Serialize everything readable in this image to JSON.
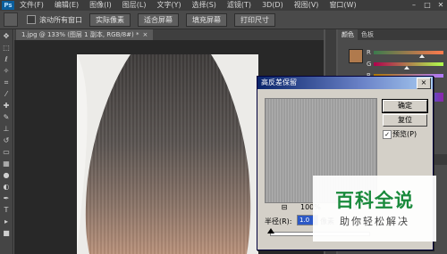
{
  "menubar": {
    "logo": "Ps",
    "items": [
      "文件(F)",
      "编辑(E)",
      "图像(I)",
      "图层(L)",
      "文字(Y)",
      "选择(S)",
      "滤镜(T)",
      "3D(D)",
      "视图(V)",
      "窗口(W)"
    ],
    "window_controls": [
      "–",
      "□",
      "✕"
    ]
  },
  "options_bar": {
    "scroll_all_label": "滚动所有窗口",
    "buttons": [
      "实际像素",
      "适合屏幕",
      "填充屏幕",
      "打印尺寸"
    ]
  },
  "document_tab": {
    "title": "1.jpg @ 133% (图层 1 副本, RGB/8#) *",
    "close": "×"
  },
  "panel": {
    "tabs": [
      "颜色",
      "色板"
    ],
    "foreground_color": "#b07a4d",
    "sliders": [
      {
        "label": "R",
        "gradient": [
          "#3b7a4d",
          "#ff7a4d"
        ],
        "value": 176
      },
      {
        "label": "G",
        "gradient": [
          "#b0004d",
          "#b0ff4d"
        ],
        "value": 122
      },
      {
        "label": "B",
        "gradient": [
          "#b07a00",
          "#b07aff"
        ],
        "value": 77
      }
    ]
  },
  "dialog": {
    "title": "高反差保留",
    "close": "×",
    "ok_label": "确定",
    "reset_label": "复位",
    "preview_checkbox": {
      "checked": true,
      "mark": "✓",
      "label": "预览(P)"
    },
    "zoom": {
      "minus": "⊟",
      "value": "100%",
      "plus": "⊞"
    },
    "radius": {
      "label": "半径(R):",
      "value": "1.0",
      "unit": "像素",
      "slider_position": 0
    }
  },
  "watermark": {
    "title": "百科全说",
    "subtitle": "助你轻松解决"
  },
  "colors": {
    "menubar_bg": "#3c3c3c",
    "workspace_bg": "#535353",
    "dialog_bg": "#d4d0c8",
    "dialog_title_from": "#0a246a",
    "watermark_green": "#1a8a3c"
  }
}
